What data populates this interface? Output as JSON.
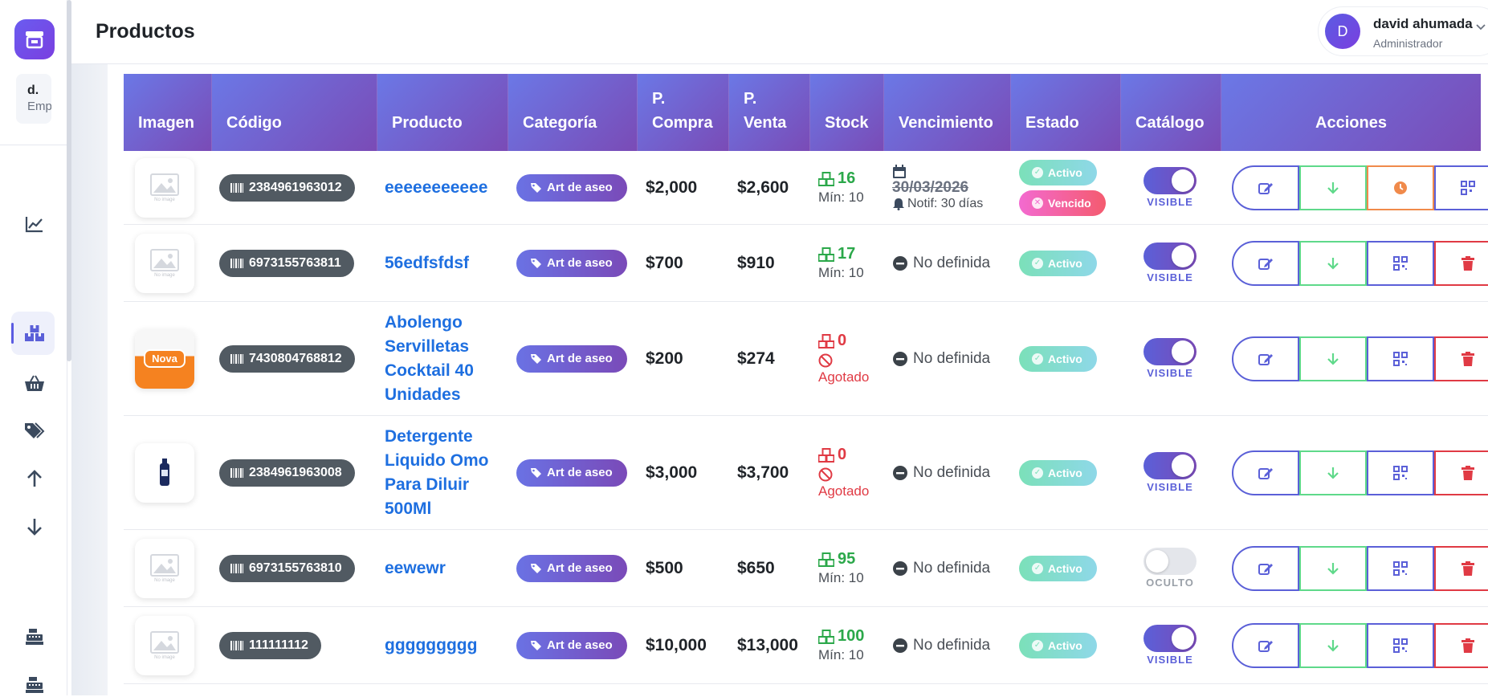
{
  "sidebar": {
    "logo_icon": "store-icon",
    "company_initial": "d.",
    "company_name": "Empresa",
    "nav_icons": [
      "chart-line-icon",
      "boxes-icon",
      "basket-icon",
      "tags-icon",
      "arrow-up-icon",
      "arrow-down-icon",
      "cash-register-icon",
      "cash-register-icon"
    ]
  },
  "header": {
    "title": "Productos",
    "user_initial": "D",
    "user_name": "david ahumada",
    "user_role": "Administrador"
  },
  "table": {
    "columns": [
      "Imagen",
      "Código",
      "Producto",
      "Categoría",
      "P. Compra",
      "P. Venta",
      "Stock",
      "Vencimiento",
      "Estado",
      "Catálogo",
      "Acciones"
    ],
    "no_image_text": "No image",
    "rows": [
      {
        "code": "2384961963012",
        "product": "eeeeeeeeeee",
        "category": "Art de aseo",
        "buy": "$2,000",
        "sell": "$2,600",
        "stock": "16",
        "stock_note": "Mín: 10",
        "expiry": "30/03/2026",
        "expiry_notif": "Notif: 30 días",
        "status": [
          "Activo",
          "Vencido"
        ],
        "catalog": "VISIBLE"
      },
      {
        "code": "6973155763811",
        "product": "56edfsfdsf",
        "category": "Art de aseo",
        "buy": "$700",
        "sell": "$910",
        "stock": "17",
        "stock_note": "Mín: 10",
        "expiry": "No definida",
        "status": [
          "Activo"
        ],
        "catalog": "VISIBLE"
      },
      {
        "code": "7430804768812",
        "product": "Abolengo Servilletas Cocktail 40 Unidades",
        "category": "Art de aseo",
        "buy": "$200",
        "sell": "$274",
        "stock": "0",
        "stock_note": "Agotado",
        "expiry": "No definida",
        "status": [
          "Activo"
        ],
        "catalog": "VISIBLE",
        "image_brand": "Nova"
      },
      {
        "code": "2384961963008",
        "product": "Detergente Liquido Omo Para Diluir 500Ml",
        "category": "Art de aseo",
        "buy": "$3,000",
        "sell": "$3,700",
        "stock": "0",
        "stock_note": "Agotado",
        "expiry": "No definida",
        "status": [
          "Activo"
        ],
        "catalog": "VISIBLE"
      },
      {
        "code": "6973155763810",
        "product": "eewewr",
        "category": "Art de aseo",
        "buy": "$500",
        "sell": "$650",
        "stock": "95",
        "stock_note": "Mín: 10",
        "expiry": "No definida",
        "status": [
          "Activo"
        ],
        "catalog": "OCULTO"
      },
      {
        "code": "111111112",
        "product": "ggggggggg",
        "category": "Art de aseo",
        "buy": "$10,000",
        "sell": "$13,000",
        "stock": "100",
        "stock_note": "Mín: 10",
        "expiry": "No definida",
        "status": [
          "Activo"
        ],
        "catalog": "VISIBLE"
      }
    ]
  },
  "colors": {
    "header_gradient_start": "#6b78e6",
    "header_gradient_end": "#7a4bb6",
    "link": "#1e6fe0",
    "stock_ok": "#2ba84a",
    "stock_out": "#e03a44",
    "edit": "#5b60d8",
    "download": "#5fd98a",
    "history": "#f08a4b",
    "delete": "#e03a44"
  }
}
